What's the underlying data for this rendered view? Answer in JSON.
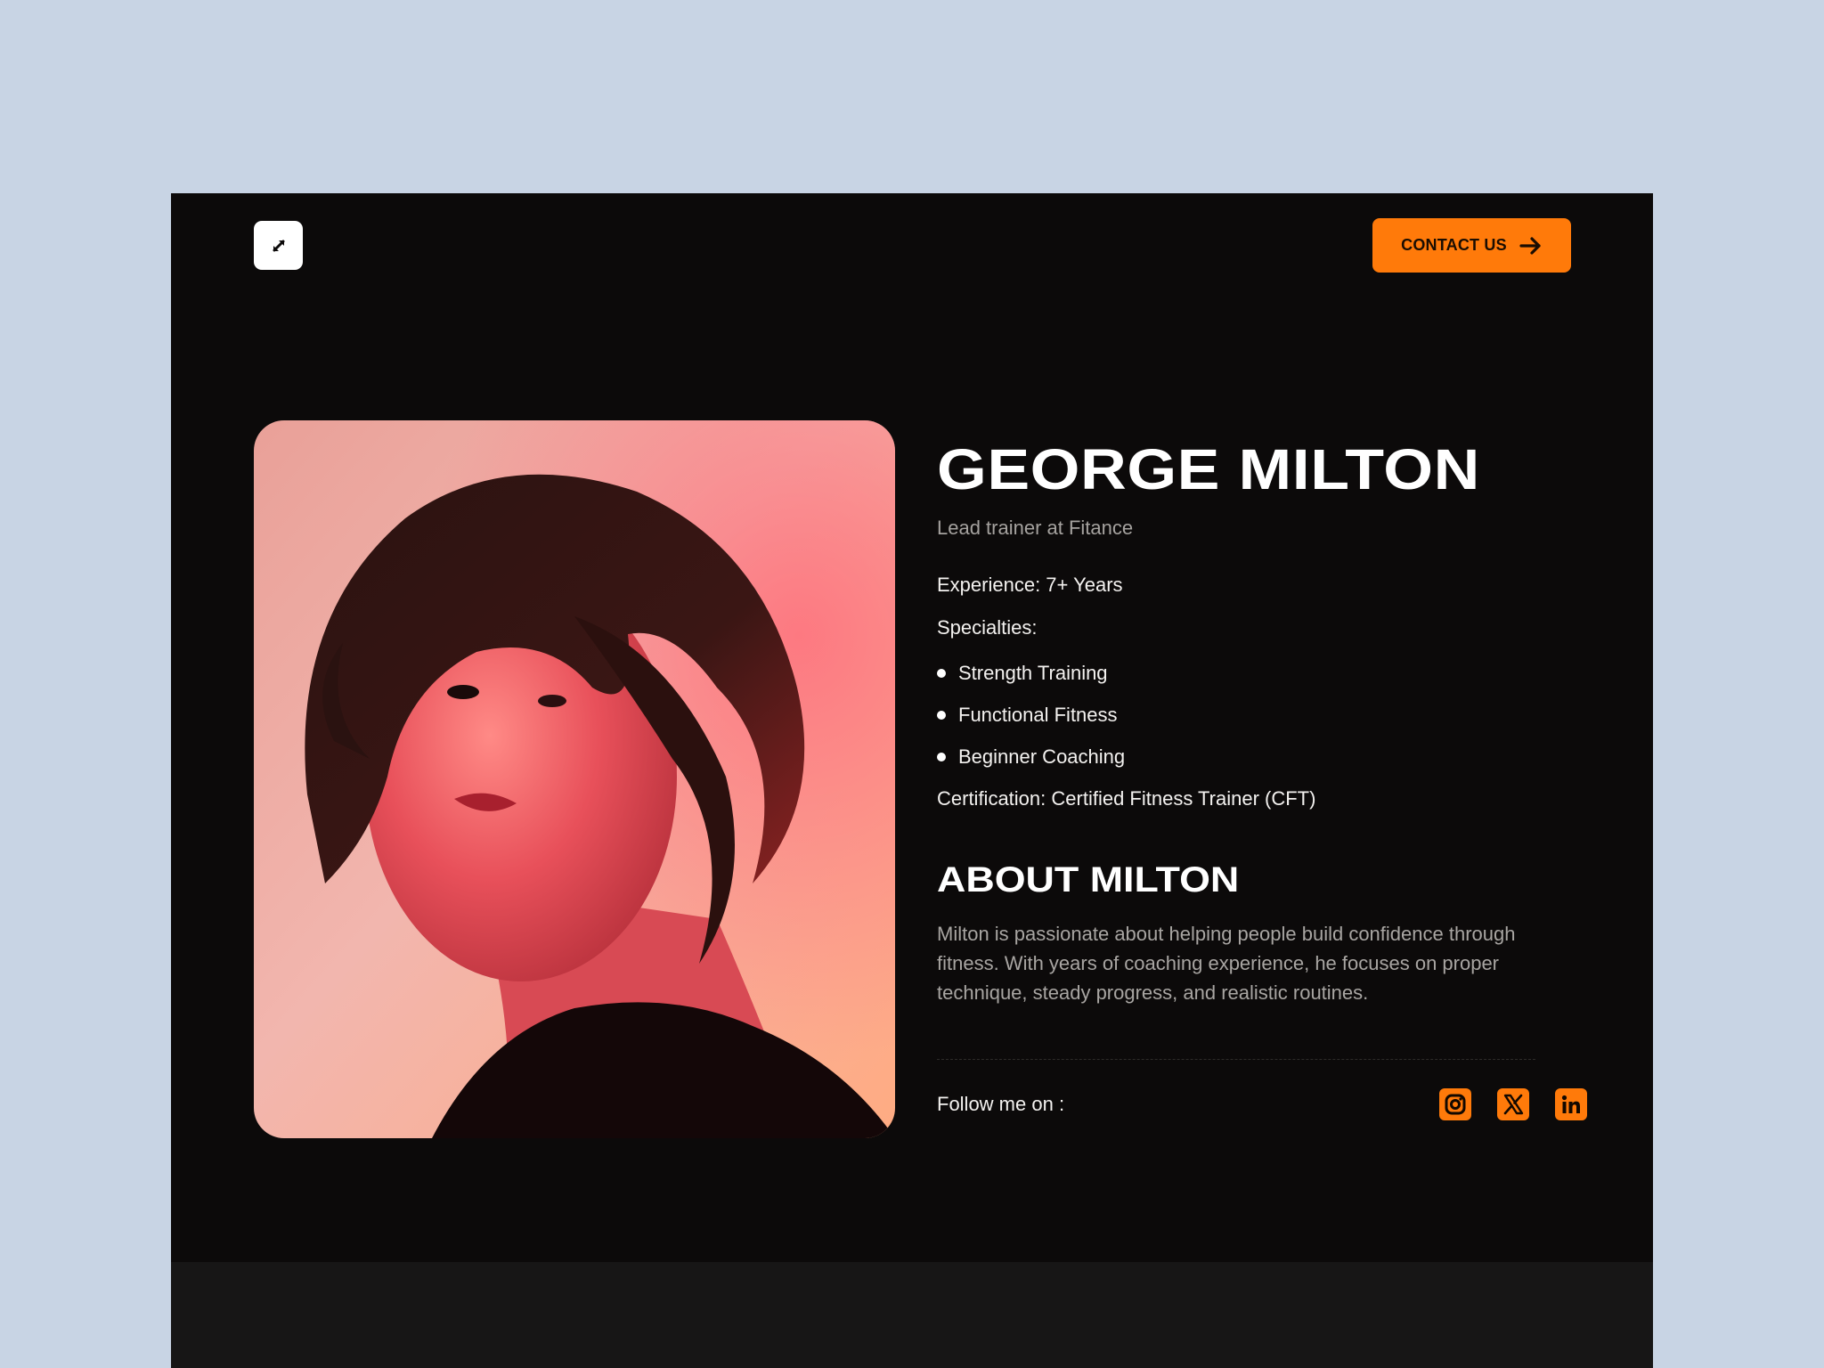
{
  "header": {
    "logo_icon": "expand-arrows-icon",
    "contact_button": {
      "label": "CONTACT US",
      "icon": "arrow-right-icon"
    }
  },
  "profile": {
    "photo_alt": "Portrait of George Milton",
    "name": "GEORGE MILTON",
    "role": "Lead trainer at Fitance",
    "experience": "Experience: 7+ Years",
    "specialties_label": "Specialties:",
    "specialties": [
      "Strength Training",
      "Functional Fitness",
      "Beginner Coaching"
    ],
    "certification": "Certification: Certified Fitness Trainer (CFT)"
  },
  "about": {
    "title": "ABOUT MILTON",
    "text": "Milton is passionate about helping people build confidence through fitness. With years of coaching experience, he focuses on proper technique, steady progress, and realistic routines."
  },
  "follow": {
    "label": "Follow me on :",
    "socials": [
      {
        "name": "Instagram",
        "icon": "instagram-icon"
      },
      {
        "name": "X",
        "icon": "x-icon"
      },
      {
        "name": "LinkedIn",
        "icon": "linkedin-icon"
      }
    ]
  },
  "colors": {
    "page_background": "#c8d4e4",
    "card_background": "#0c0a0a",
    "accent": "#ff7a0a",
    "heading": "#ffffff",
    "muted_text": "#a5a29f"
  }
}
